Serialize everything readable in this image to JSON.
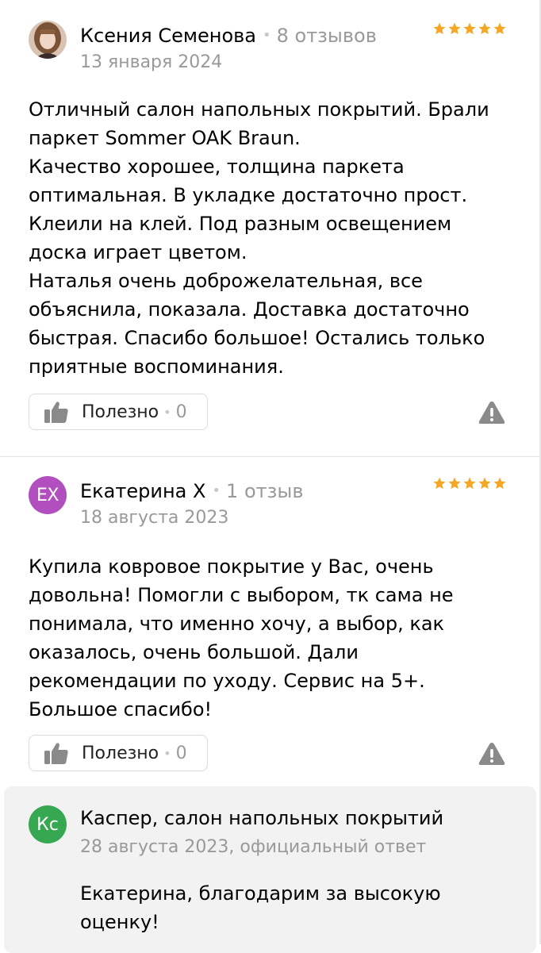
{
  "reviews": [
    {
      "author": "Ксения Семенова",
      "separator": "•",
      "review_count": "8 отзывов",
      "date": "13 января 2024",
      "rating": 5,
      "paragraphs": [
        "Отличный салон напольных покрытий. Брали паркет Sommer OAK Braun.",
        "Качество хорошее, толщина паркета оптимальная. В укладке достаточно прост. Клеили на клей. Под разным освещением доска играет цветом.",
        "Наталья очень доброжелательная, все объяснила, показала. Доставка достаточно быстрая. Спасибо большое! Остались только приятные воспоминания."
      ],
      "useful_label": "Полезно",
      "useful_count": "0"
    },
    {
      "author": "Екатерина Х",
      "separator": "•",
      "review_count": "1 отзыв",
      "date": "18 августа 2023",
      "rating": 5,
      "avatar_initials": "ЕХ",
      "avatar_color": "#b14fbf",
      "paragraphs": [
        "Купила ковровое покрытие у Вас, очень довольна! Помогли с выбором, тк сама не понимала, что именно хочу, а выбор, как оказалось, очень большой. Дали рекомендации по уходу. Сервис на 5+.",
        "Большое спасибо!"
      ],
      "useful_label": "Полезно",
      "useful_count": "0",
      "business_answer": {
        "avatar_initials": "Кс",
        "avatar_color": "#36a852",
        "org_name": "Каспер, салон напольных покрытий",
        "date": "28 августа 2023, официальный ответ",
        "text": "Екатерина, благодарим за высокую оценку!"
      }
    }
  ],
  "colors": {
    "star": "#f5a623",
    "muted_text": "#999999",
    "border": "#dcdcdc",
    "icon_gray": "#8a8a8a",
    "answer_bg": "#f2f2f2"
  },
  "icons": {
    "useful": "thumbs-up-icon",
    "report": "warning-triangle-icon",
    "rating": "star-icon"
  }
}
